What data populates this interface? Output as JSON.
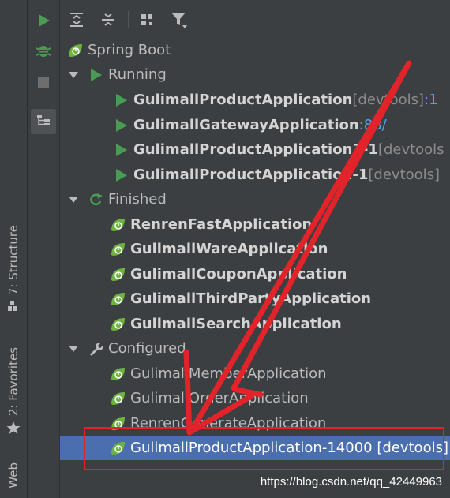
{
  "side_tabs": {
    "structure": "7: Structure",
    "favorites": "2: Favorites",
    "web": "Web"
  },
  "icons": {
    "run": "run-icon",
    "debug": "debug-icon",
    "stop": "stop-icon",
    "layout": "layout-icon",
    "expand_all": "expand-all-icon",
    "collapse_all": "collapse-all-icon",
    "group": "group-icon",
    "filter": "filter-icon"
  },
  "colors": {
    "green": "#499c54",
    "spring": "#6db33f",
    "selection": "#4b6eaf",
    "port": "#589df6",
    "annotation_red": "#e3232a"
  },
  "tree": {
    "root": "Spring Boot",
    "running": {
      "label": "Running",
      "items": [
        {
          "name": "GulimallProductApplication",
          "suffix": " [devtools] ",
          "port": ":1"
        },
        {
          "name": "GulimallGatewayApplication",
          "suffix": " ",
          "port": ":88/"
        },
        {
          "name": "GulimallProductApplication1-1",
          "suffix": " [devtools",
          "port": ""
        },
        {
          "name": "GulimallProductApplication-1",
          "suffix": " [devtools]",
          "port": ""
        }
      ]
    },
    "finished": {
      "label": "Finished",
      "items": [
        "RenrenFastApplication",
        "GulimallWareApplication",
        "GulimallCouponApplication",
        "GulimallThirdPartyApplication",
        "GulimallSearchApplication"
      ]
    },
    "configured": {
      "label": "Configured",
      "items": [
        "GulimallMemberApplication",
        "GulimallOrderApplication",
        "RenrenGenerateApplication"
      ],
      "selected": "GulimallProductApplication-14000 [devtools]"
    }
  },
  "watermark": "https://blog.csdn.net/qq_42449963"
}
